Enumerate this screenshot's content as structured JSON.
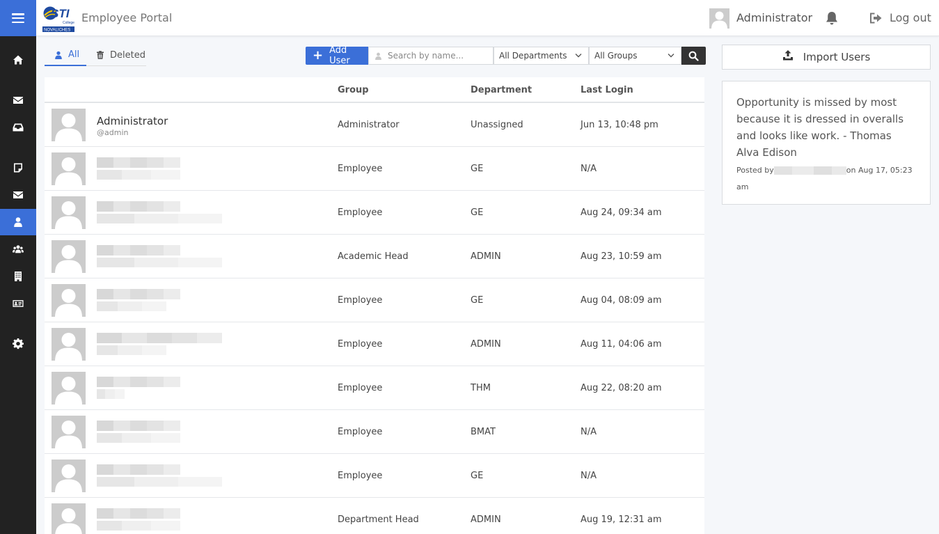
{
  "header": {
    "portal_title": "Employee Portal",
    "user_name": "Administrator",
    "logout_label": "Log out"
  },
  "tabs": {
    "all_label": "All",
    "deleted_label": "Deleted"
  },
  "toolbar": {
    "add_user_label": "Add User",
    "search_placeholder": "Search by name...",
    "department_selected": "All Departments",
    "group_selected": "All Groups"
  },
  "table": {
    "columns": {
      "group": "Group",
      "department": "Department",
      "last_login": "Last Login"
    },
    "rows": [
      {
        "name": "Administrator",
        "handle": "@admin",
        "group": "Administrator",
        "department": "Unassigned",
        "last_login": "Jun 13, 10:48 pm"
      },
      {
        "name": "",
        "handle": "",
        "group": "Employee",
        "department": "GE",
        "last_login": "N/A"
      },
      {
        "name": "",
        "handle": "",
        "group": "Employee",
        "department": "GE",
        "last_login": "Aug 24, 09:34 am"
      },
      {
        "name": "",
        "handle": "",
        "group": "Academic Head",
        "department": "ADMIN",
        "last_login": "Aug 23, 10:59 am"
      },
      {
        "name": "",
        "handle": "",
        "group": "Employee",
        "department": "GE",
        "last_login": "Aug 04, 08:09 am"
      },
      {
        "name": "",
        "handle": "",
        "group": "Employee",
        "department": "ADMIN",
        "last_login": "Aug 11, 04:06 am"
      },
      {
        "name": "",
        "handle": "",
        "group": "Employee",
        "department": "THM",
        "last_login": "Aug 22, 08:20 am"
      },
      {
        "name": "",
        "handle": "",
        "group": "Employee",
        "department": "BMAT",
        "last_login": "N/A"
      },
      {
        "name": "",
        "handle": "",
        "group": "Employee",
        "department": "GE",
        "last_login": "N/A"
      },
      {
        "name": "",
        "handle": "",
        "group": "Department Head",
        "department": "ADMIN",
        "last_login": "Aug 19, 12:31 am"
      }
    ]
  },
  "side": {
    "import_label": "Import Users",
    "quote": "Opportunity is missed by most because it is dressed in overalls and looks like work. - Thomas Alva Edison",
    "posted_by_prefix": "Posted by",
    "posted_on": "on Aug 17, 05:23 am"
  },
  "colors": {
    "accent": "#3b6fd8",
    "sidebar": "#222222"
  },
  "icons": {
    "sidebar": [
      "home-icon",
      "envelope-icon",
      "inbox-icon",
      "note-icon",
      "mail-icon",
      "user-icon",
      "users-icon",
      "building-icon",
      "id-card-icon",
      "gear-icon"
    ]
  }
}
